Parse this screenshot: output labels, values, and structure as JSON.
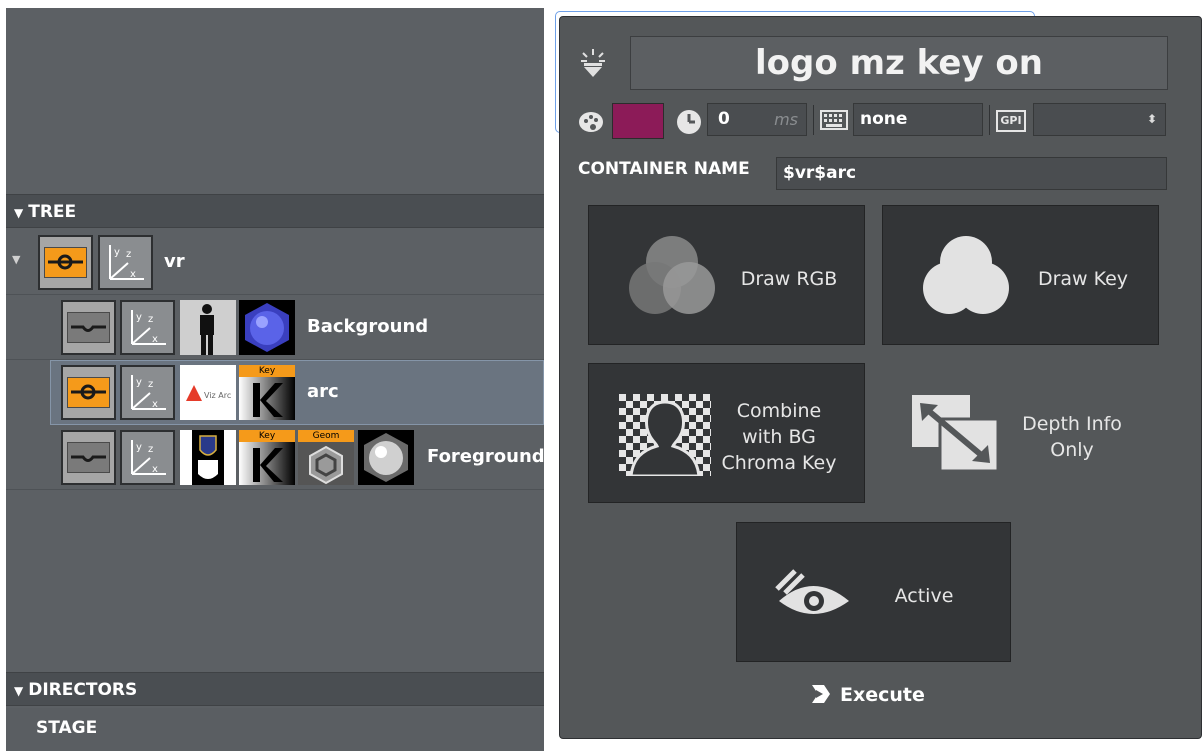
{
  "tree_panel": {
    "tree_header": "TREE",
    "directors_header": "DIRECTORS",
    "stage_label": "STAGE",
    "rows": [
      {
        "label": "vr",
        "merge_active": true
      },
      {
        "label": "Background",
        "merge_active": false
      },
      {
        "label": "arc",
        "merge_active": true,
        "selected": true
      },
      {
        "label": "Foreground",
        "merge_active": false
      }
    ],
    "thumb_texts": {
      "key": "Key",
      "geom": "Geom",
      "vizarc": "Viz Arc"
    }
  },
  "action": {
    "title": "logo mz key on",
    "color": "#8c1b58",
    "delay_value": "0",
    "delay_unit": "ms",
    "keyboard_shortcut": "none",
    "gpi_icon_label": "GPI",
    "gpi_value": "",
    "container_name_label": "CONTAINER NAME",
    "container_name_value": "$vr$arc",
    "buttons": {
      "draw_rgb": "Draw RGB",
      "draw_key": "Draw Key",
      "combine_line1": "Combine",
      "combine_line2": "with BG",
      "combine_line3": "Chroma Key",
      "depth_line1": "Depth Info",
      "depth_line2": "Only",
      "active": "Active"
    },
    "execute_label": "Execute"
  }
}
